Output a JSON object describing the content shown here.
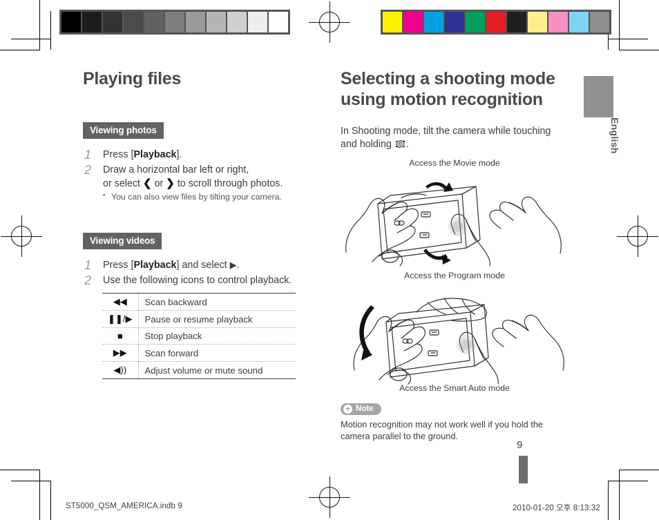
{
  "document": {
    "language_tab": "English",
    "page_number": "9"
  },
  "calibration": {
    "grayscale_label": "grayscale-calibration-bar",
    "grayscale_swatches": [
      "#000000",
      "#1c1c1c",
      "#333333",
      "#4b4b4b",
      "#626262",
      "#7d7d7d",
      "#9a9a9a",
      "#b5b5b5",
      "#cfcfcf",
      "#eeeeee",
      "#ffffff"
    ],
    "color_label": "color-calibration-bar",
    "color_swatches": [
      "#fff000",
      "#ec008c",
      "#00a0e3",
      "#2e3192",
      "#00a05a",
      "#e81c23",
      "#221f1f",
      "#fdf08a",
      "#f68fc4",
      "#7fd4f4",
      "#8f8f8f"
    ]
  },
  "left_column": {
    "title": "Playing files",
    "sections": [
      {
        "heading": "Viewing photos",
        "steps": [
          {
            "num": "1",
            "before": "Press [",
            "bold": "Playback",
            "after": "]."
          },
          {
            "num": "2",
            "line1": "Draw a horizontal bar left or right,",
            "line2_a": "or select ",
            "glyph_left": "❮",
            "line2_b": " or ",
            "glyph_right": "❯",
            "line2_c": " to scroll through photos."
          }
        ],
        "bullet": "You can also view files by tilting your camera."
      },
      {
        "heading": "Viewing videos",
        "steps": [
          {
            "num": "1",
            "before": "Press [",
            "bold": "Playback",
            "after": "] and select ",
            "icon": "▶",
            "end": "."
          },
          {
            "num": "2",
            "text": "Use the following icons to control playback."
          }
        ]
      }
    ],
    "icon_table": {
      "rows": [
        {
          "icon": "◀◀",
          "icon_name": "scan-backward-icon",
          "label": "Scan backward"
        },
        {
          "icon": "❚❚/▶",
          "icon_name": "pause-resume-icon",
          "label": "Pause or resume playback"
        },
        {
          "icon": "■",
          "icon_name": "stop-icon",
          "label": "Stop playback"
        },
        {
          "icon": "▶▶",
          "icon_name": "scan-forward-icon",
          "label": "Scan forward"
        },
        {
          "icon": "◀))",
          "icon_name": "volume-icon",
          "label": "Adjust volume or mute sound"
        }
      ]
    }
  },
  "right_column": {
    "title_line1": "Selecting a shooting mode",
    "title_line2": "using motion recognition",
    "intro_line1": "In Shooting mode, tilt the camera while touching",
    "intro_line2_a": "and holding ",
    "intro_line2_b": ".",
    "intro_icon_name": "motion-recognition-icon",
    "illustration_1": {
      "caption_top": "Access the Movie mode",
      "caption_bottom": "Access the Program mode",
      "alt": "hands holding camera tilting up and down"
    },
    "illustration_2": {
      "caption_bottom": "Access the Smart Auto mode",
      "alt": "hands holding camera tilting left"
    },
    "note": {
      "badge": "Note",
      "text": "Motion recognition may not work well if you hold the camera parallel to the ground."
    }
  },
  "footer": {
    "filename": "ST5000_QSM_AMERICA.indb   9",
    "timestamp": "2010-01-20   오후 8:13:32"
  }
}
